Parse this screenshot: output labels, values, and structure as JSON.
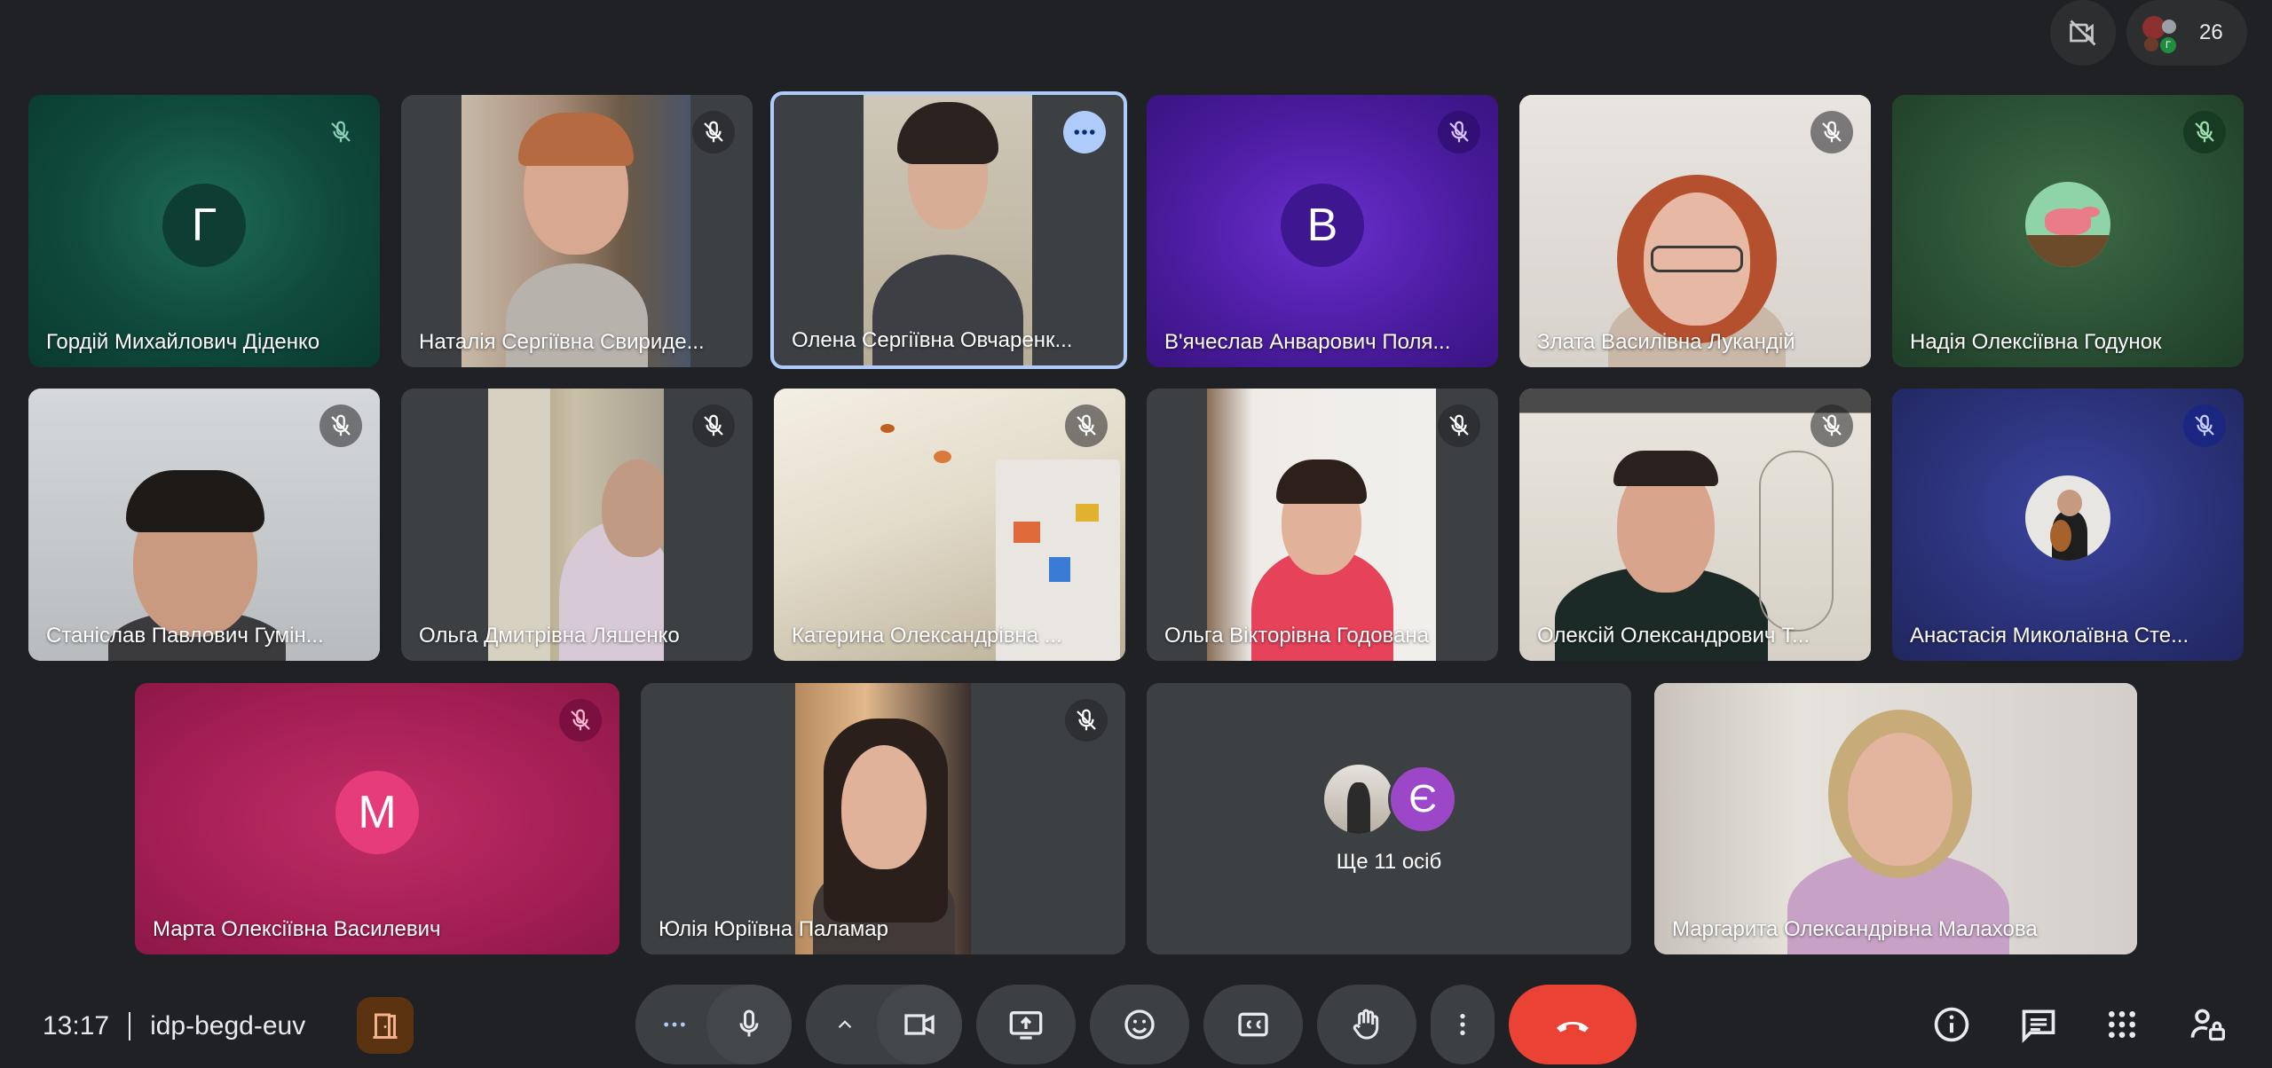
{
  "top": {
    "camera_off_icon": "video-off-icon",
    "participant_count": "26"
  },
  "tiles": [
    {
      "name": "Гордій Михайлович Діденко",
      "initial": "Г"
    },
    {
      "name": "Наталія Сергіївна Свириде..."
    },
    {
      "name": "Олена Сергіївна Овчаренк..."
    },
    {
      "name": "В'ячеслав Анварович Поля...",
      "initial": "В"
    },
    {
      "name": "Злата Василівна Лукандій"
    },
    {
      "name": "Надія Олексіївна Годунок"
    },
    {
      "name": "Станіслав Павлович Гумін..."
    },
    {
      "name": "Ольга Дмитрівна Ляшенко"
    },
    {
      "name": "Катерина Олександрівна ..."
    },
    {
      "name": "Ольга Вікторівна Годована"
    },
    {
      "name": "Олексій Олександрович Т..."
    },
    {
      "name": "Анастасія Миколаївна Сте..."
    },
    {
      "name": "Марта Олексіївна Василевич",
      "initial": "M"
    },
    {
      "name": "Юлія Юріївна Паламар"
    },
    {
      "name": "Ще 11 осіб",
      "initial": "Є"
    },
    {
      "name": "Маргарита Олександрівна Малахова"
    }
  ],
  "bottom": {
    "time": "13:17",
    "meeting_code": "idp-begd-euv"
  },
  "colors": {
    "background": "#202124",
    "leave": "#ea4335",
    "active_outline": "#aecbfa",
    "tile_green": "#0f4a3c",
    "tile_purple": "#4a1c9e",
    "tile_navy": "#2a3176",
    "tile_pink": "#b0225a"
  }
}
